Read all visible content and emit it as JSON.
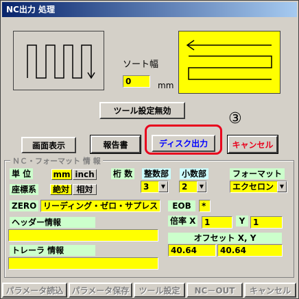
{
  "window": {
    "title": "NC出力 処理"
  },
  "sort": {
    "label": "ソート幅",
    "value": "0",
    "unit": "mm"
  },
  "buttons": {
    "tool_disable": "ツール設定無効",
    "screen_display": "画面表示",
    "report": "報告書",
    "disk_output": "ディスク出力",
    "cancel": "キャンセル"
  },
  "annotation": {
    "marker": "③",
    "highlight_color": "#e8001c"
  },
  "nc_format": {
    "group_title": "ＮＣ・フォーマット 情 報",
    "unit_label": "単 位",
    "unit_mm": "mm",
    "unit_inch": "inch",
    "digits_label": "桁 数",
    "integer_label": "整数部",
    "integer_value": "3",
    "decimal_label": "小数部",
    "decimal_value": "2",
    "format_label": "フォーマット",
    "format_value": "エクセロン",
    "coord_label": "座標系",
    "coord_abs": "絶対",
    "coord_rel": "相対",
    "zero_label": "ZERO",
    "zero_value": "リーディング・ゼロ・サプレス",
    "eob_label": "EOB",
    "eob_value": "*",
    "header_label": "ヘッダー情報",
    "header_value": "",
    "scale_label": "倍率 X",
    "scale_x": "1",
    "scale_y_label": "Y",
    "scale_y": "1",
    "trailer_label": "トレーラ 情報",
    "trailer_value": "",
    "offset_label": "オフセット X, Y",
    "offset_x": "40.64",
    "offset_y": "40.64"
  },
  "bottom_buttons": [
    "パラメータ読込",
    "パラメータ保存",
    "ツール設定",
    "NC－OUT",
    "キャンセル"
  ]
}
